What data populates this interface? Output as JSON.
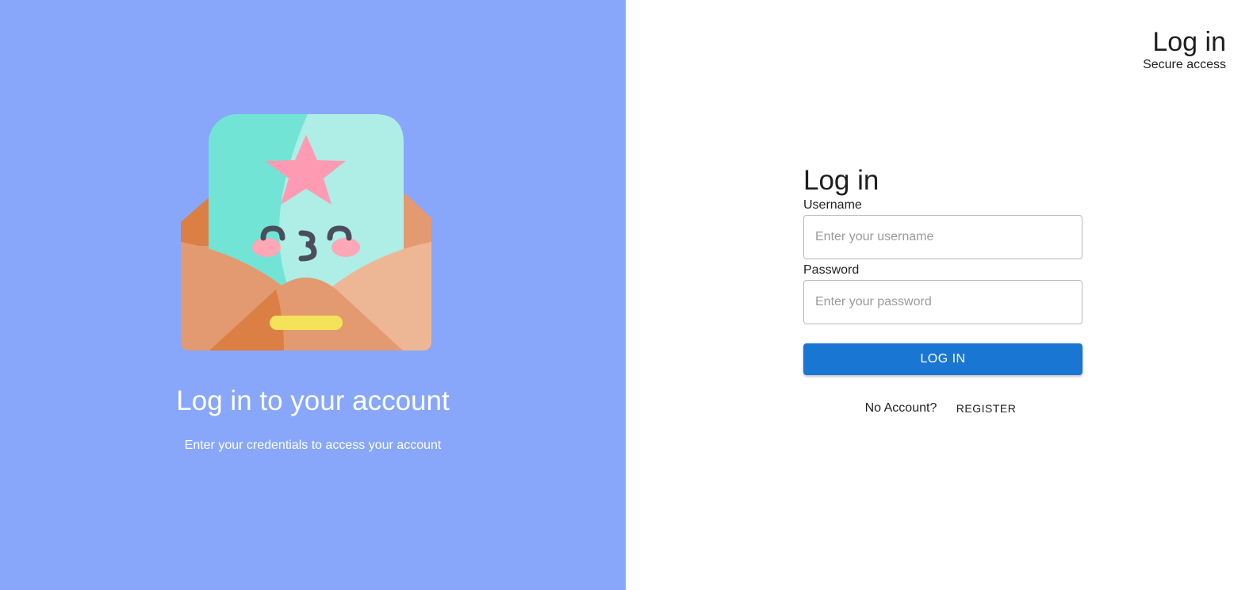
{
  "header": {
    "title": "Log in",
    "subtitle": "Secure access"
  },
  "hero": {
    "illustration": "envelope-letter-with-star-illustration",
    "title": "Log in to your account",
    "subtitle": "Enter your credentials to access your account"
  },
  "form": {
    "title": "Log in",
    "username": {
      "label": "Username",
      "placeholder": "Enter your username",
      "value": ""
    },
    "password": {
      "label": "Password",
      "placeholder": "Enter your password",
      "value": ""
    },
    "submit_label": "LOG IN",
    "no_account_text": "No Account?",
    "register_label": "REGISTER"
  },
  "colors": {
    "left_panel_bg": "#88a7fb",
    "primary_button": "#1976d2"
  }
}
